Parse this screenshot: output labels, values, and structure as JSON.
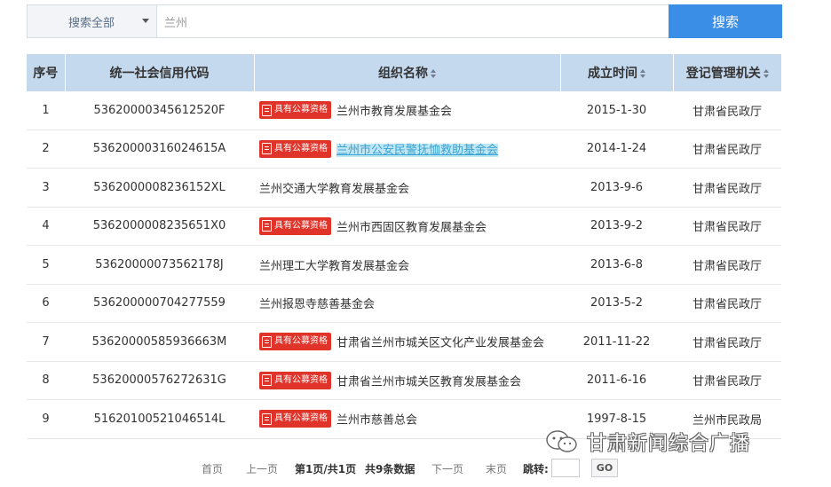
{
  "search": {
    "scope_label": "搜索全部",
    "query_value": "兰州",
    "button_label": "搜索"
  },
  "table": {
    "headers": [
      "序号",
      "统一社会信用代码",
      "组织名称",
      "成立时间",
      "登记管理机关"
    ],
    "badge_label": "具有公募资格",
    "rows": [
      {
        "no": "1",
        "code": "53620000345612520F",
        "org": "兰州市教育发展基金会",
        "date": "2015-1-30",
        "authority": "甘肃省民政厅"
      },
      {
        "no": "2",
        "code": "53620000316024615A",
        "org": "兰州市公安民警抚恤救助基金会",
        "date": "2014-1-24",
        "authority": "甘肃省民政厅"
      },
      {
        "no": "3",
        "code": "5362000008236152XL",
        "org": "兰州交通大学教育发展基金会",
        "date": "2013-9-6",
        "authority": "甘肃省民政厅"
      },
      {
        "no": "4",
        "code": "5362000008235651X0",
        "org": "兰州市西固区教育发展基金会",
        "date": "2013-9-2",
        "authority": "甘肃省民政厅"
      },
      {
        "no": "5",
        "code": "53620000073562178J",
        "org": "兰州理工大学教育发展基金会",
        "date": "2013-6-8",
        "authority": "甘肃省民政厅"
      },
      {
        "no": "6",
        "code": "536200000704277559",
        "org": "兰州报恩寺慈善基金会",
        "date": "2013-5-2",
        "authority": "甘肃省民政厅"
      },
      {
        "no": "7",
        "code": "53620000585936663M",
        "org": "甘肃省兰州市城关区文化产业发展基金会",
        "date": "2011-11-22",
        "authority": "甘肃省民政厅"
      },
      {
        "no": "8",
        "code": "53620000576272631G",
        "org": "甘肃省兰州市城关区教育发展基金会",
        "date": "2011-6-16",
        "authority": "甘肃省民政厅"
      },
      {
        "no": "9",
        "code": "51620100521046514L",
        "org": "兰州市慈善总会",
        "date": "1997-8-15",
        "authority": "兰州市民政局"
      }
    ],
    "badge_rows": [
      1,
      2,
      4,
      7,
      8,
      9
    ],
    "highlight_row": 2
  },
  "pagination": {
    "first": "首页",
    "prev": "上一页",
    "current": "第1页/共1页",
    "total": "共9条数据",
    "next": "下一页",
    "last": "末页",
    "jump_label": "跳转:",
    "go": "GO"
  },
  "watermark": {
    "text": "甘肃新闻综合广播",
    "icon": "wechat-icon"
  },
  "colors": {
    "header_bg": "#c5d9ee",
    "search_button": "#3a8ee6",
    "badge_red": "#e0332a",
    "highlight": "#bfe6f5"
  }
}
